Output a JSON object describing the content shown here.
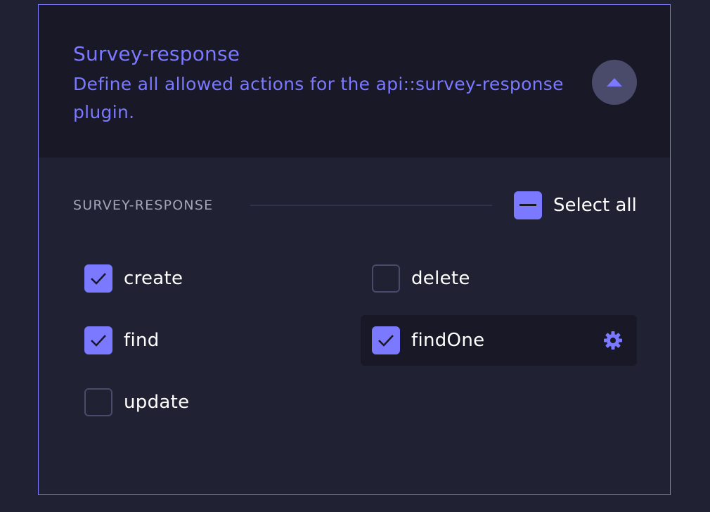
{
  "header": {
    "title": "Survey-response",
    "description": "Define all allowed actions for the api::survey-response plugin."
  },
  "section": {
    "label": "SURVEY-RESPONSE",
    "select_all_label": "Select all",
    "select_all_state": "indeterminate"
  },
  "permissions": [
    {
      "label": "create",
      "checked": true
    },
    {
      "label": "delete",
      "checked": false
    },
    {
      "label": "find",
      "checked": true
    },
    {
      "label": "findOne",
      "checked": true,
      "has_settings": true
    },
    {
      "label": "update",
      "checked": false
    }
  ],
  "icons": {
    "collapse": "chevron-up-icon",
    "settings": "gear-icon",
    "check": "check-icon",
    "indeterminate": "minus-icon"
  },
  "colors": {
    "accent": "#7b79ff",
    "background": "#212134",
    "header_background": "#181826",
    "text": "#ffffff",
    "muted_text": "#a5a5ba"
  }
}
